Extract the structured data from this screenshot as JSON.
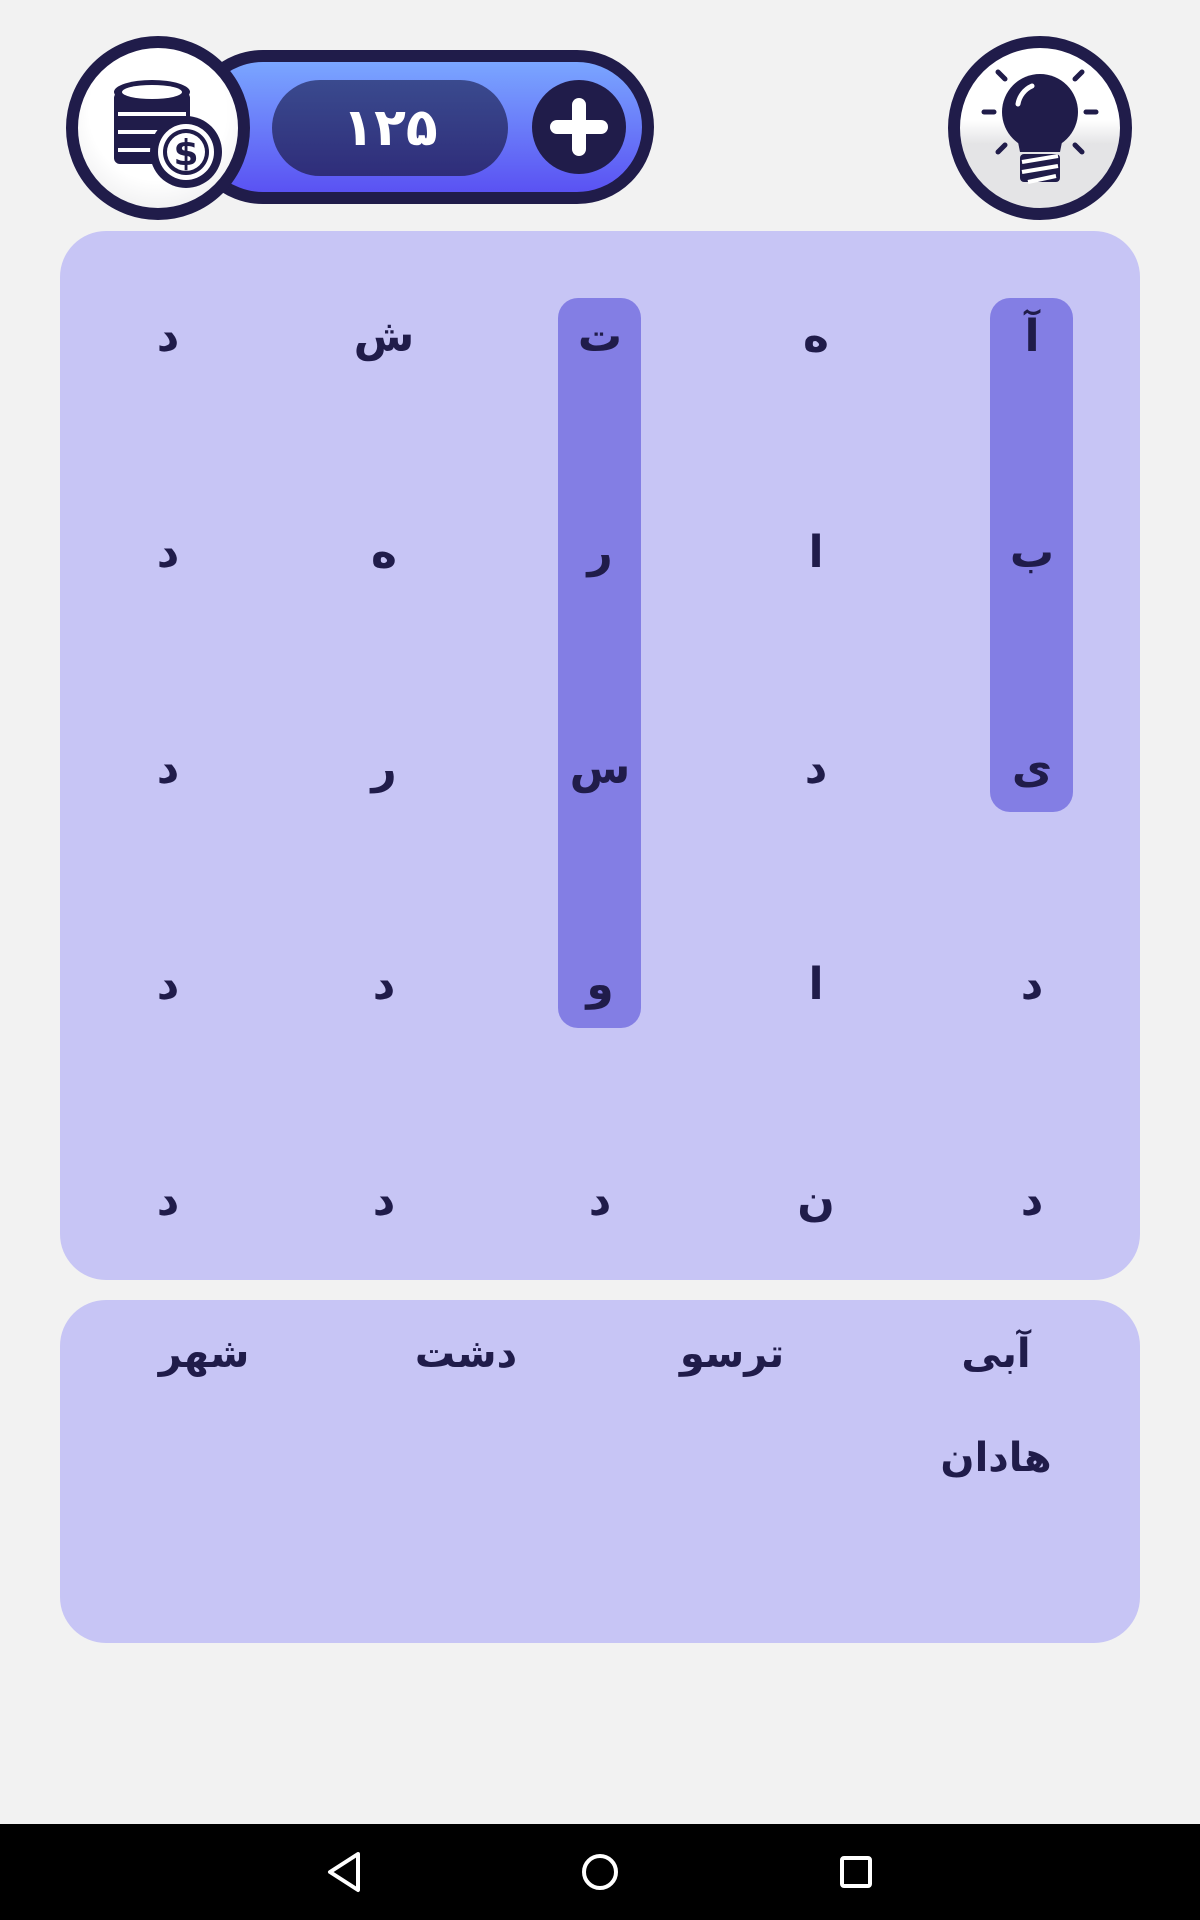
{
  "coins": {
    "balance": "۱۲۵"
  },
  "colors": {
    "board_bg": "#c7c5f5",
    "highlight": "#837ee4",
    "text_dark": "#201c4a",
    "coin_pill_top": "#7aa6ff",
    "coin_pill_bottom": "#5a52f3",
    "page_bg": "#f2f2f2"
  },
  "icons": {
    "coin": "coins-stack-dollar-icon",
    "add": "plus-icon",
    "hint": "light-bulb-icon",
    "nav_back": "triangle-back-icon",
    "nav_home": "circle-home-icon",
    "nav_recents": "square-recents-icon"
  },
  "grid": {
    "rows": [
      [
        "آ",
        "ه",
        "ت",
        "ش",
        "د"
      ],
      [
        "ب",
        "ا",
        "ر",
        "ه",
        "د"
      ],
      [
        "ی",
        "د",
        "س",
        "ر",
        "د"
      ],
      [
        "د",
        "ا",
        "و",
        "د",
        "د"
      ],
      [
        "د",
        "ن",
        "د",
        "د",
        "د"
      ]
    ]
  },
  "words": {
    "row1": [
      "آبی",
      "ترسو",
      "دشت",
      "شهر"
    ],
    "row2": [
      "هادان"
    ]
  }
}
